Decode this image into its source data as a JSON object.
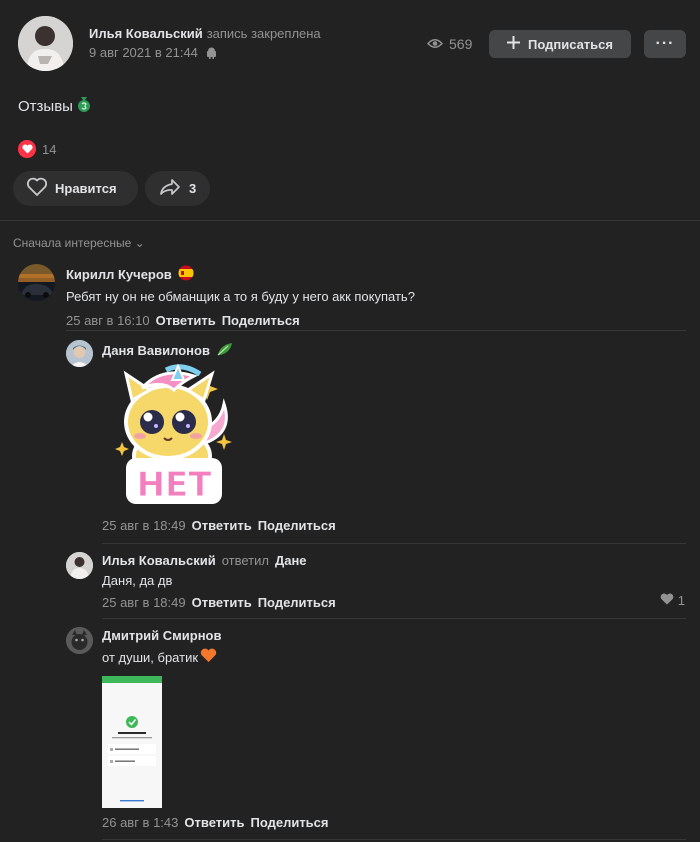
{
  "post": {
    "author": "Илья Ковальский",
    "pinned_note": "запись закреплена",
    "date": "9 авг 2021 в 21:44",
    "views": "569",
    "subscribe_label": "Подписаться",
    "more_label": "···",
    "text": "Отзывы",
    "reactions_count": "14",
    "like_label": "Нравится",
    "share_count": "3"
  },
  "comments_sort": "Сначала интересные ⌄",
  "comments": [
    {
      "author": "Кирилл Кучеров",
      "text": "Ребят ну он не обманщик а то я буду у него акк покупать?",
      "date": "25 авг в 16:10",
      "reply_label": "Ответить",
      "share_label": "Поделиться"
    },
    {
      "author": "Даня Вавилонов",
      "sticker_text": "НЕТ",
      "date": "25 авг в 18:49",
      "reply_label": "Ответить",
      "share_label": "Поделиться"
    },
    {
      "author": "Илья Ковальский",
      "replied": "ответил",
      "reply_to": "Дане",
      "text": "Даня, да дв",
      "date": "25 авг в 18:49",
      "reply_label": "Ответить",
      "share_label": "Поделиться",
      "likes": "1"
    },
    {
      "author": "Дмитрий Смирнов",
      "text": "от души, братик",
      "date": "26 авг в 1:43",
      "reply_label": "Ответить",
      "share_label": "Поделиться"
    }
  ],
  "colors": {
    "background": "#222222",
    "button": "#454647",
    "like_red": "#ff3347",
    "muted": "#939393"
  }
}
